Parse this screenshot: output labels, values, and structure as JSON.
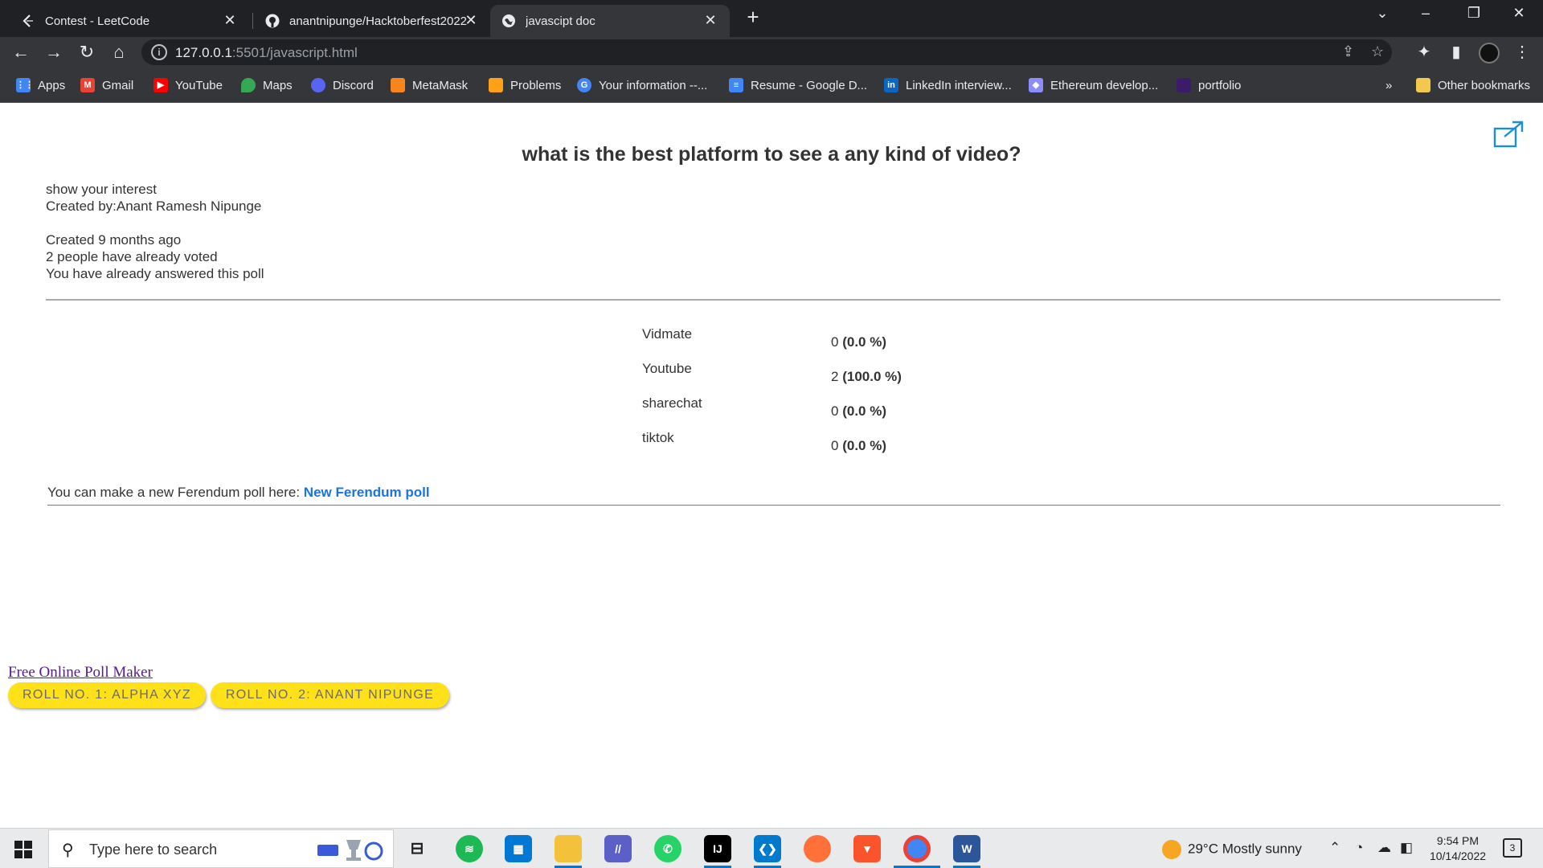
{
  "browser": {
    "tabs": [
      {
        "title": "Contest - LeetCode",
        "active": false,
        "icon": "leetcode-icon"
      },
      {
        "title": "anantnipunge/Hacktoberfest2022",
        "active": false,
        "icon": "github-icon"
      },
      {
        "title": "javascipt doc",
        "active": true,
        "icon": "globe-icon"
      }
    ],
    "new_tab": "+",
    "url_host": "127.0.0.1",
    "url_rest": ":5501/javascript.html",
    "bookmarks": [
      {
        "label": "Apps",
        "icon": "apps-grid-icon",
        "color": "#4285f4"
      },
      {
        "label": "Gmail",
        "icon": "gmail-icon",
        "color": "#ea4335"
      },
      {
        "label": "YouTube",
        "icon": "youtube-icon",
        "color": "#ff0000"
      },
      {
        "label": "Maps",
        "icon": "maps-icon",
        "color": "#34a853"
      },
      {
        "label": "Discord",
        "icon": "discord-icon",
        "color": "#5865f2"
      },
      {
        "label": "MetaMask",
        "icon": "metamask-icon",
        "color": "#f6851b"
      },
      {
        "label": "Problems",
        "icon": "leetcode-icon",
        "color": "#ffa116"
      },
      {
        "label": "Your information --...",
        "icon": "google-icon",
        "color": "#4285f4"
      },
      {
        "label": "Resume - Google D...",
        "icon": "google-docs-icon",
        "color": "#4285f4"
      },
      {
        "label": "LinkedIn interview...",
        "icon": "linkedin-icon",
        "color": "#0a66c2"
      },
      {
        "label": "Ethereum develop...",
        "icon": "ethereum-icon",
        "color": "#8c8dfc"
      },
      {
        "label": "portfolio",
        "icon": "portfolio-icon",
        "color": "#3b1c6b"
      }
    ],
    "more_bookmarks": "»",
    "other_bookmarks": "Other bookmarks"
  },
  "poll": {
    "title": "what is the best platform to see a any kind of video?",
    "description": "show your interest",
    "created_by": "Created by:Anant Ramesh Nipunge",
    "created_ago": "Created 9 months ago",
    "votes_text": "2 people have already voted",
    "answered_text": "You have already answered this poll",
    "options": [
      {
        "label": "Vidmate",
        "count": "0",
        "percent": "(0.0 %)"
      },
      {
        "label": "Youtube",
        "count": "2",
        "percent": "(100.0 %)"
      },
      {
        "label": "sharechat",
        "count": "0",
        "percent": "(0.0 %)"
      },
      {
        "label": "tiktok",
        "count": "0",
        "percent": "(0.0 %)"
      }
    ],
    "new_poll_text": "You can make a new Ferendum poll here:",
    "new_poll_link": "New Ferendum poll",
    "footer_link": "Free Online Poll Maker",
    "roll_buttons": [
      "ROLL NO. 1: ALPHA XYZ",
      "ROLL NO. 2: ANANT NIPUNGE"
    ]
  },
  "taskbar": {
    "search_placeholder": "Type here to search",
    "weather": "29°C  Mostly sunny",
    "time": "9:54 PM",
    "date": "10/14/2022",
    "notifications": "3",
    "apps": [
      {
        "name": "task-view-icon",
        "color": "#e8eaec"
      },
      {
        "name": "spotify-icon",
        "color": "#1db954"
      },
      {
        "name": "microsoft-store-icon",
        "color": "#0078d4"
      },
      {
        "name": "file-explorer-icon",
        "color": "#f3c13a"
      },
      {
        "name": "app-icon",
        "color": "#5b5fc7"
      },
      {
        "name": "whatsapp-icon",
        "color": "#25d366"
      },
      {
        "name": "intellij-icon",
        "color": "#000000"
      },
      {
        "name": "vscode-icon",
        "color": "#007acc"
      },
      {
        "name": "firefox-icon",
        "color": "#ff7139"
      },
      {
        "name": "brave-icon",
        "color": "#fb542b"
      },
      {
        "name": "chrome-icon",
        "color": "#4285f4"
      },
      {
        "name": "word-icon",
        "color": "#2b579a"
      }
    ]
  },
  "colors": {
    "accent_link": "#1a73e8",
    "roll_button": "#ffe11a"
  }
}
